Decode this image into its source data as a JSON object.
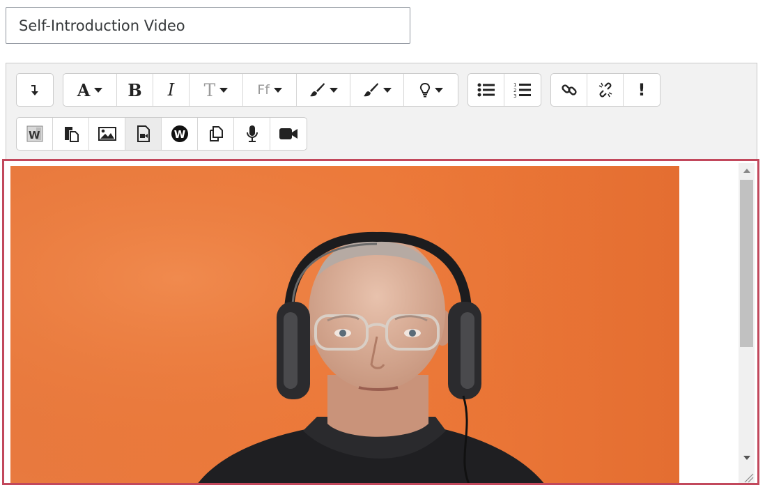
{
  "title_field": {
    "value": "Self-Introduction Video"
  },
  "toolbar": {
    "row1": [
      {
        "group": "collapse",
        "buttons": [
          {
            "name": "show-more-buttons",
            "icon": "arrow-down-icon"
          }
        ]
      },
      {
        "group": "style",
        "buttons": [
          {
            "name": "font-style-menu",
            "glyph": "A",
            "icon": "font-style-icon"
          },
          {
            "name": "bold",
            "glyph": "B",
            "icon": "bold-icon"
          },
          {
            "name": "italic",
            "glyph": "I",
            "icon": "italic-icon"
          },
          {
            "name": "font-size-menu",
            "glyph": "T",
            "icon": "font-size-icon"
          },
          {
            "name": "font-family-menu",
            "glyph": "Ff",
            "icon": "font-family-icon"
          },
          {
            "name": "text-color-menu",
            "icon": "brush-icon"
          },
          {
            "name": "background-color-menu",
            "icon": "brush-icon"
          },
          {
            "name": "highlight-menu",
            "icon": "lightbulb-icon"
          }
        ]
      },
      {
        "group": "lists",
        "buttons": [
          {
            "name": "unordered-list",
            "icon": "bullet-list-icon"
          },
          {
            "name": "ordered-list",
            "icon": "numbered-list-icon"
          }
        ]
      },
      {
        "group": "links",
        "buttons": [
          {
            "name": "link",
            "icon": "link-icon"
          },
          {
            "name": "unlink",
            "icon": "unlink-icon"
          },
          {
            "name": "accessibility-checker",
            "glyph": "!",
            "icon": "exclamation-icon"
          }
        ]
      }
    ],
    "row2": [
      {
        "name": "paste-from-word",
        "glyph": "W",
        "icon": "word-icon"
      },
      {
        "name": "paste",
        "icon": "paste-icon"
      },
      {
        "name": "insert-image",
        "icon": "image-icon"
      },
      {
        "name": "insert-media",
        "icon": "media-file-icon",
        "active": true
      },
      {
        "name": "wiris",
        "glyph": "W",
        "icon": "wiris-icon"
      },
      {
        "name": "copy",
        "icon": "copy-icon"
      },
      {
        "name": "record-audio",
        "icon": "microphone-icon"
      },
      {
        "name": "record-video",
        "icon": "video-camera-icon"
      }
    ]
  },
  "content": {
    "video_description": "webcam-frame"
  },
  "colors": {
    "focus_border": "#c2485c",
    "video_background": "#ee7a3a"
  }
}
